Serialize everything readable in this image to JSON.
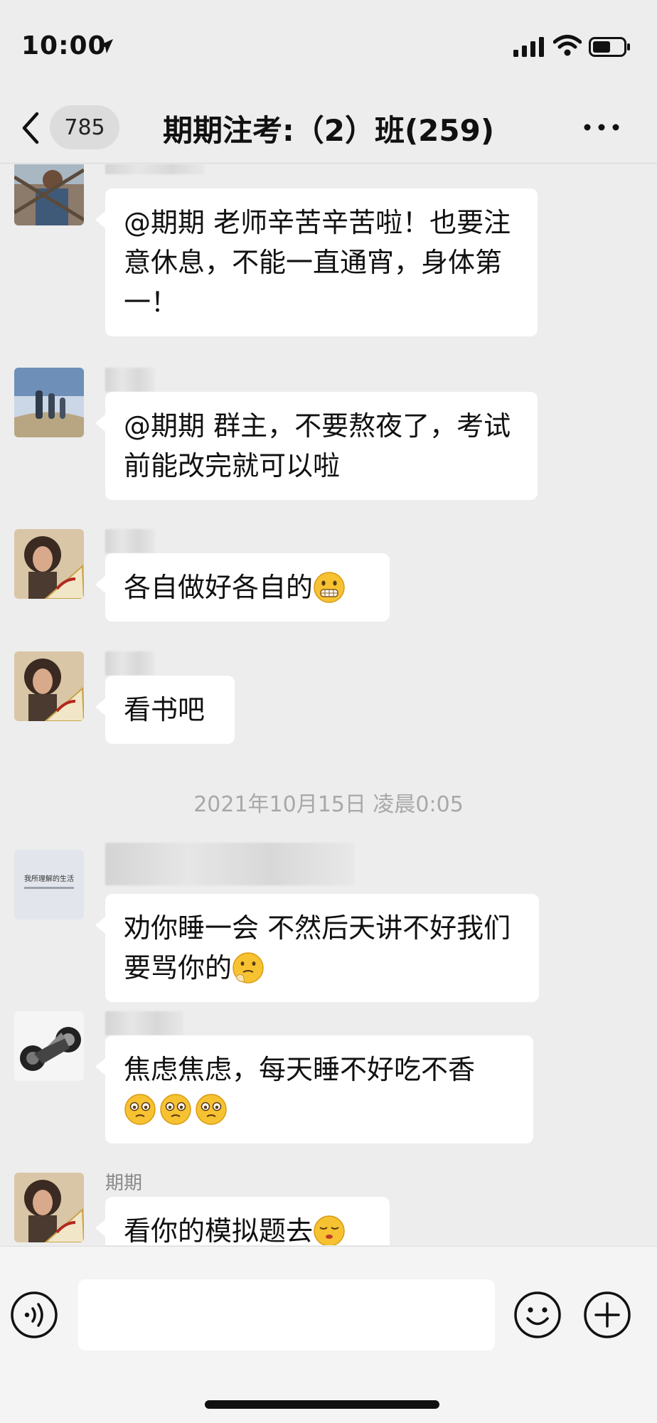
{
  "status_bar": {
    "time": "10:00"
  },
  "nav": {
    "unread_count": "785",
    "title": "期期注考:（2）班(259)"
  },
  "messages": [
    {
      "avatar": "kid-photo-avatar",
      "text": "@期期 老师辛苦辛苦啦！也要注意休息，不能一直通宵，身体第一！"
    },
    {
      "avatar": "hikers-photo-avatar",
      "text": "@期期 群主，不要熬夜了，考试前能改完就可以啦"
    },
    {
      "avatar": "woman-fan-avatar",
      "text": "各自做好各自的",
      "emoji": "grimace-emoji"
    },
    {
      "avatar": "woman-fan-avatar",
      "text": "看书吧"
    },
    {
      "avatar": "text-card-avatar",
      "avatar_text": "我所理解的生活",
      "text": "劝你睡一会 不然后天讲不好我们要骂你的",
      "emoji": "thinking-emoji"
    },
    {
      "avatar": "motorcycle-avatar",
      "text": "焦虑焦虑，每天睡不好吃不香",
      "emoji": "worried-emoji"
    },
    {
      "avatar": "woman-fan-avatar",
      "nickname": "期期",
      "text": "看你的模拟题去",
      "emoji": "relieved-emoji"
    }
  ],
  "date_separator": "2021年10月15日 凌晨0:05",
  "colors": {
    "background": "#ededed",
    "bubble": "#ffffff",
    "nav_pill": "#dcdcdc",
    "timestamp": "#a8a8a8"
  }
}
